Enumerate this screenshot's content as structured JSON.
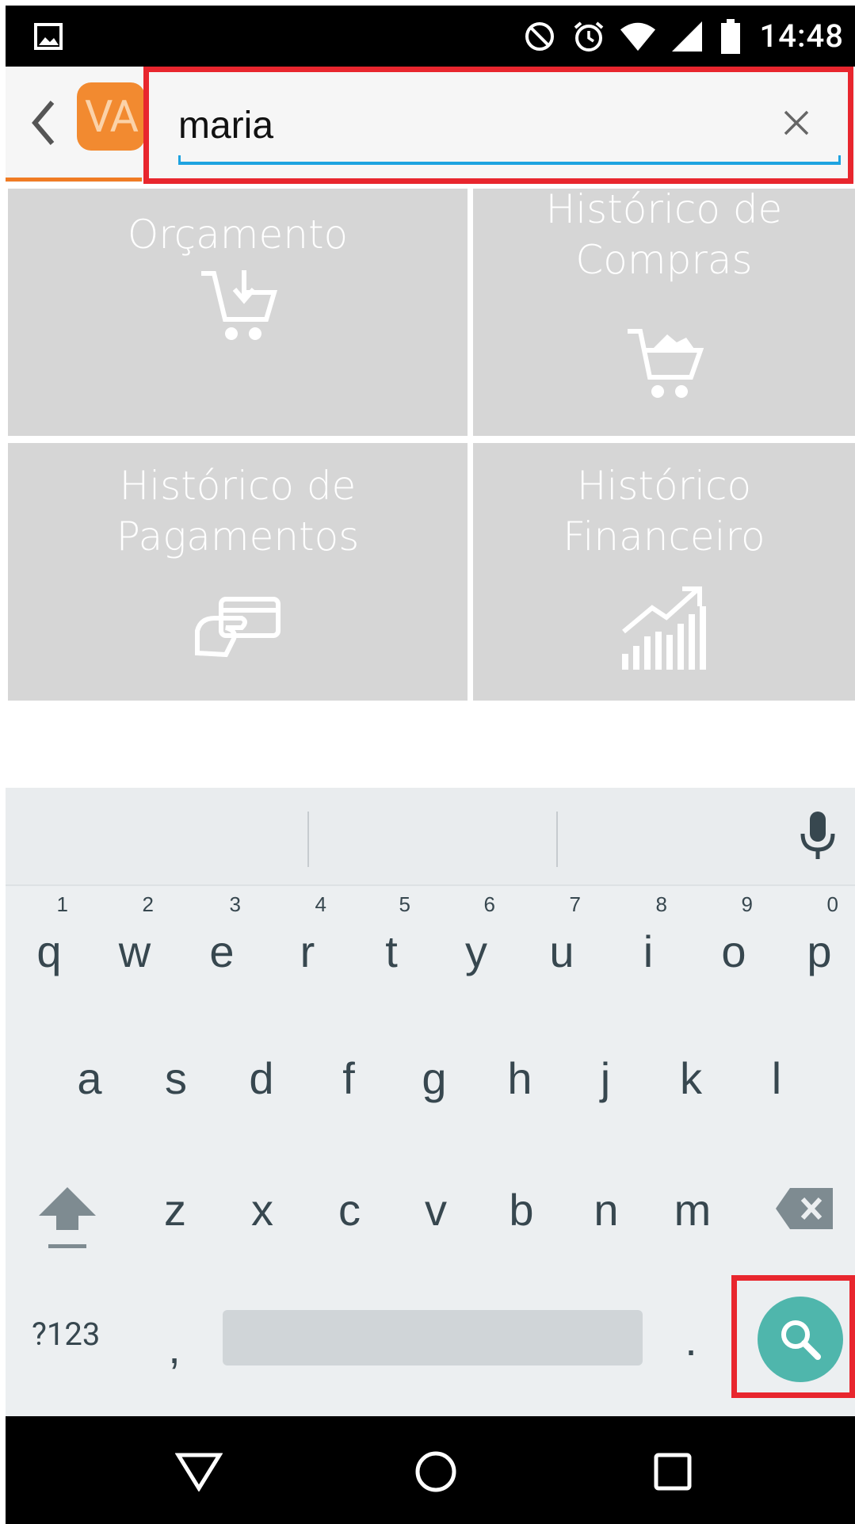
{
  "status_bar": {
    "time": "14:48",
    "icons": [
      "image-icon",
      "do-not-disturb-icon",
      "alarm-icon",
      "wifi-icon",
      "cell-signal-icon",
      "battery-icon"
    ]
  },
  "toolbar": {
    "back_icon": "chevron-left-icon",
    "avatar_text": "VA",
    "search_value": "maria",
    "clear_icon": "close-icon",
    "accent_color": "#f07b23",
    "underline_color": "#1ea3e0"
  },
  "tiles": [
    {
      "label": "Orçamento",
      "icon": "cart-download-icon"
    },
    {
      "label": "Histórico de Compras",
      "icon": "cart-full-icon"
    },
    {
      "label": "Histórico de Pagamentos",
      "icon": "card-payment-icon"
    },
    {
      "label": "Histórico Financeiro",
      "icon": "growth-chart-icon"
    }
  ],
  "keyboard": {
    "row1": [
      {
        "k": "q",
        "n": "1"
      },
      {
        "k": "w",
        "n": "2"
      },
      {
        "k": "e",
        "n": "3"
      },
      {
        "k": "r",
        "n": "4"
      },
      {
        "k": "t",
        "n": "5"
      },
      {
        "k": "y",
        "n": "6"
      },
      {
        "k": "u",
        "n": "7"
      },
      {
        "k": "i",
        "n": "8"
      },
      {
        "k": "o",
        "n": "9"
      },
      {
        "k": "p",
        "n": "0"
      }
    ],
    "row2": [
      "a",
      "s",
      "d",
      "f",
      "g",
      "h",
      "j",
      "k",
      "l"
    ],
    "row3": [
      "z",
      "x",
      "c",
      "v",
      "b",
      "n",
      "m"
    ],
    "symbols_label": "?123",
    "comma": ",",
    "period": ".",
    "search_key_color": "#4fb6ac"
  },
  "nav_bar": {
    "icons": [
      "back-triangle-icon",
      "home-circle-icon",
      "recents-square-icon"
    ]
  }
}
